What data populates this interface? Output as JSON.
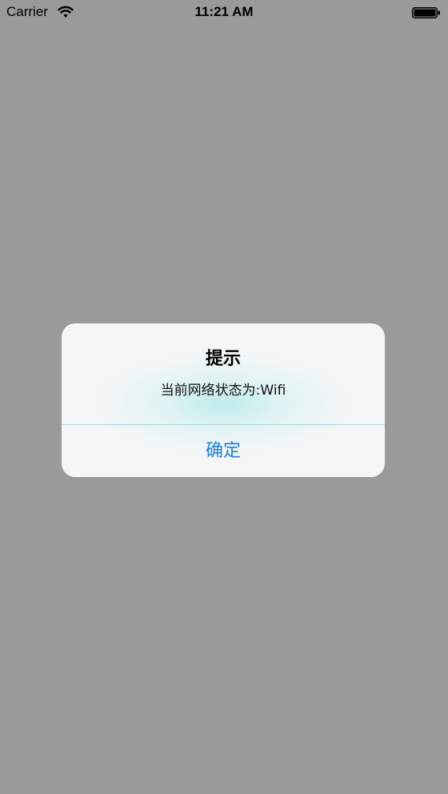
{
  "status_bar": {
    "carrier": "Carrier",
    "time": "11:21 AM",
    "wifi_icon": "wifi-icon",
    "battery_icon": "battery-icon"
  },
  "alert": {
    "title": "提示",
    "message": "当前网络状态为:Wifi",
    "confirm_button_label": "确定"
  },
  "colors": {
    "background_dim": "#9a9a9a",
    "alert_background": "#f5f6f6",
    "accent": "#1a7fde",
    "divider": "#a9d3d8"
  }
}
